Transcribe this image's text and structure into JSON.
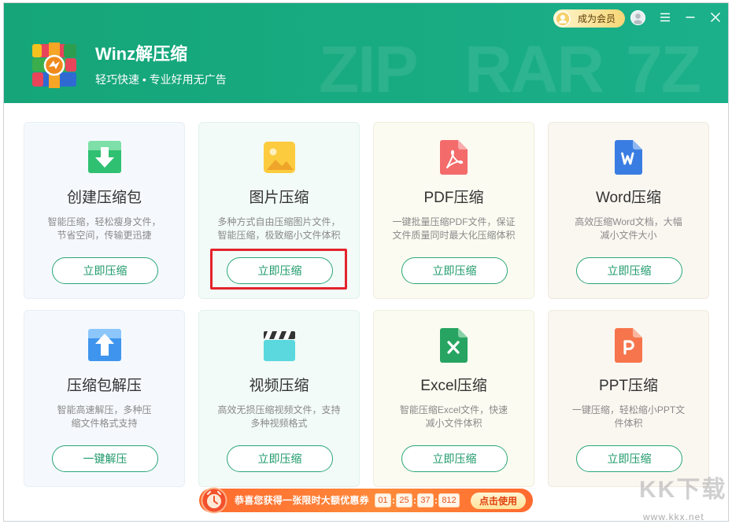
{
  "app": {
    "title": "Winz解压缩",
    "subtitle": "轻巧快速 • 专业好用无广告",
    "header_watermark": [
      "ZIP",
      "RAR",
      "7Z"
    ],
    "member_button": "成为会员"
  },
  "theme": {
    "header_gradient_start": "#15a578",
    "header_gradient_end": "#1bb08a",
    "accent_green": "#1f9a6b",
    "annotation_red": "#e3232c",
    "banner_orange": "#ff6f33"
  },
  "icons": {
    "logo": "winz-archive-logo-icon",
    "member": "vip-avatar-icon",
    "user": "user-avatar-icon",
    "menu": "menu-icon",
    "minimize": "minimize-icon",
    "close": "close-icon",
    "coupon": "coupon-clock-icon"
  },
  "cards": [
    {
      "icon": "create-archive-icon",
      "title": "创建压缩包",
      "desc": [
        "智能压缩，轻松瘦身文件，",
        "节省空间，传输更迅捷"
      ],
      "button": "立即压缩"
    },
    {
      "icon": "image-icon",
      "title": "图片压缩",
      "desc": [
        "多种方式自由压缩图片文件，",
        "智能压缩，极致缩小文件体积"
      ],
      "button": "立即压缩"
    },
    {
      "icon": "pdf-icon",
      "title": "PDF压缩",
      "desc": [
        "一键批量压缩PDF文件，保证",
        "文件质量同时最大化压缩体积"
      ],
      "button": "立即压缩"
    },
    {
      "icon": "word-icon",
      "title": "Word压缩",
      "desc": [
        "高效压缩Word文档，大幅",
        "减小文件大小"
      ],
      "button": "立即压缩"
    },
    {
      "icon": "extract-archive-icon",
      "title": "压缩包解压",
      "desc": [
        "智能高速解压，多种压",
        "缩文件格式支持"
      ],
      "button": "一键解压"
    },
    {
      "icon": "video-icon",
      "title": "视频压缩",
      "desc": [
        "高效无损压缩视频文件，支持",
        "多种视频格式"
      ],
      "button": "立即压缩"
    },
    {
      "icon": "excel-icon",
      "title": "Excel压缩",
      "desc": [
        "智能压缩Excel文件，快速",
        "减小文件体积"
      ],
      "button": "立即压缩"
    },
    {
      "icon": "ppt-icon",
      "title": "PPT压缩",
      "desc": [
        "一键压缩，轻松缩小PPT文",
        "件体积"
      ],
      "button": "立即压缩"
    }
  ],
  "banner": {
    "message": "恭喜您获得一张限时大额优惠券",
    "countdown": [
      "01",
      "25",
      "37",
      "812"
    ],
    "separator": ":",
    "button": "点击使用"
  },
  "watermark": {
    "brand": "KK下载",
    "url": "www.kkx.net"
  }
}
